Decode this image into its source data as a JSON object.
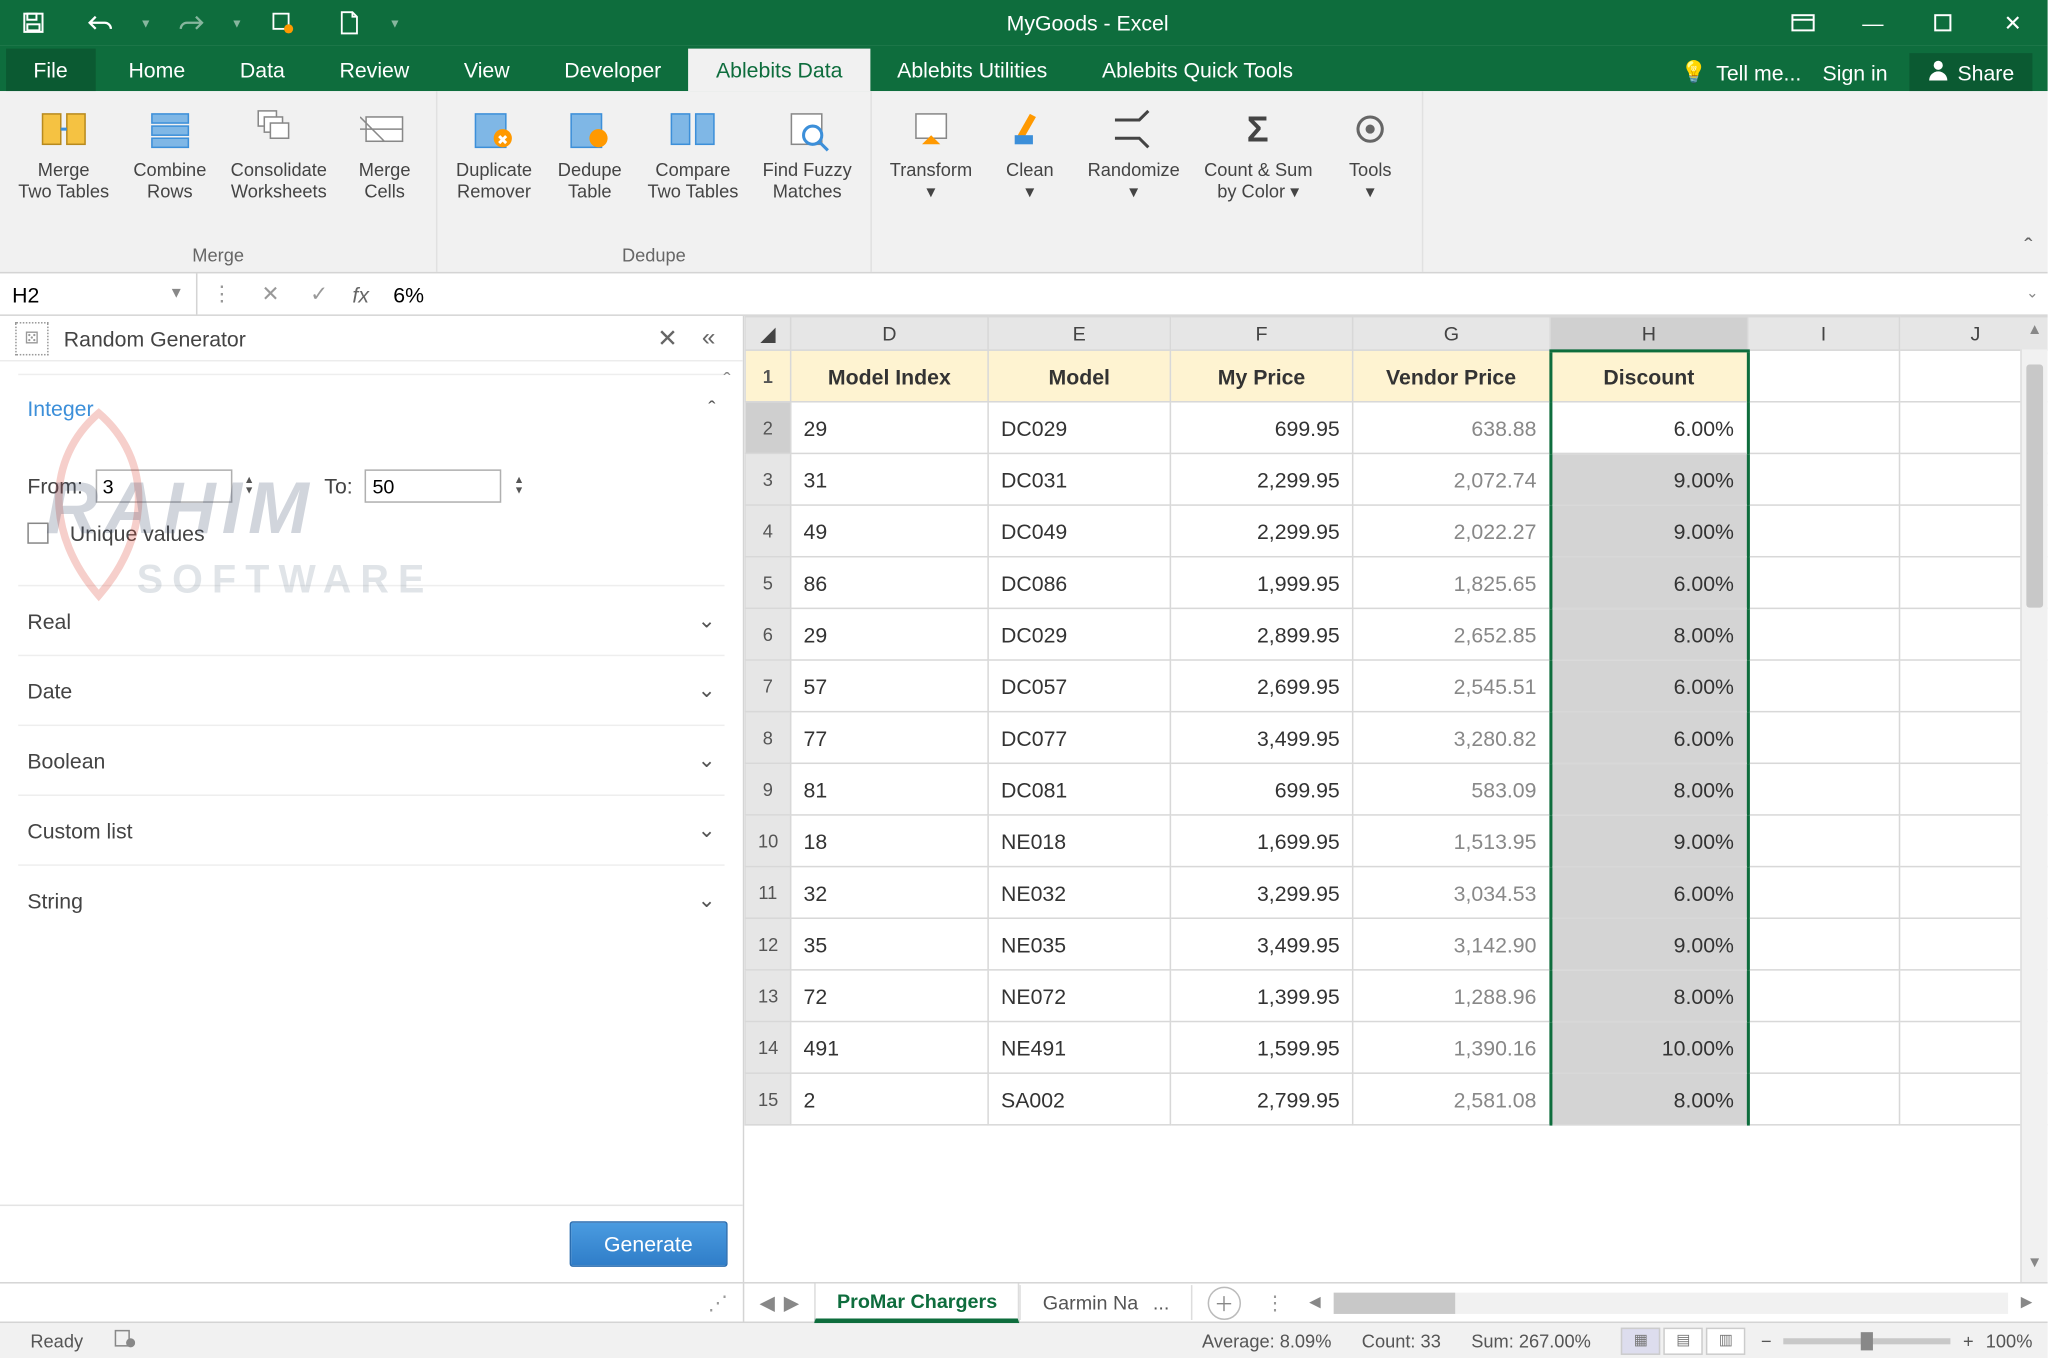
{
  "titlebar": {
    "title": "MyGoods - Excel"
  },
  "menu": {
    "file": "File",
    "tabs": [
      "Home",
      "Data",
      "Review",
      "View",
      "Developer",
      "Ablebits Data",
      "Ablebits Utilities",
      "Ablebits Quick Tools"
    ],
    "active": "Ablebits Data",
    "tell_me": "Tell me...",
    "sign_in": "Sign in",
    "share": "Share"
  },
  "ribbon": {
    "groups": [
      {
        "label": "Merge",
        "buttons": [
          {
            "label": "Merge\nTwo Tables",
            "icon": "merge-two-tables"
          },
          {
            "label": "Combine\nRows",
            "icon": "combine-rows"
          },
          {
            "label": "Consolidate\nWorksheets",
            "icon": "consolidate"
          },
          {
            "label": "Merge\nCells",
            "icon": "merge-cells"
          }
        ]
      },
      {
        "label": "Dedupe",
        "buttons": [
          {
            "label": "Duplicate\nRemover",
            "icon": "dup-remover"
          },
          {
            "label": "Dedupe\nTable",
            "icon": "dedupe-table"
          },
          {
            "label": "Compare\nTwo Tables",
            "icon": "compare"
          },
          {
            "label": "Find Fuzzy\nMatches",
            "icon": "fuzzy"
          }
        ]
      },
      {
        "label": "",
        "buttons": [
          {
            "label": "Transform\n▾",
            "icon": "transform"
          },
          {
            "label": "Clean\n▾",
            "icon": "clean"
          },
          {
            "label": "Randomize\n▾",
            "icon": "randomize"
          },
          {
            "label": "Count & Sum\nby Color ▾",
            "icon": "sigma"
          },
          {
            "label": "Tools\n▾",
            "icon": "gear"
          }
        ]
      }
    ]
  },
  "fbar": {
    "name": "H2",
    "value": "6%"
  },
  "taskpane": {
    "title": "Random Generator",
    "sections": [
      "Integer",
      "Real",
      "Date",
      "Boolean",
      "Custom list",
      "String"
    ],
    "from_label": "From:",
    "from_value": "3",
    "to_label": "To:",
    "to_value": "50",
    "unique": "Unique values",
    "generate": "Generate"
  },
  "columns": [
    "D",
    "E",
    "F",
    "G",
    "H",
    "I",
    "J"
  ],
  "headers": [
    "Model Index",
    "Model",
    "My Price",
    "Vendor Price",
    "Discount"
  ],
  "rows": [
    {
      "n": 2,
      "idx": "29",
      "model": "DC029",
      "price": "699.95",
      "vprice": "638.88",
      "disc": "6.00%",
      "active": true
    },
    {
      "n": 3,
      "idx": "31",
      "model": "DC031",
      "price": "2,299.95",
      "vprice": "2,072.74",
      "disc": "9.00%"
    },
    {
      "n": 4,
      "idx": "49",
      "model": "DC049",
      "price": "2,299.95",
      "vprice": "2,022.27",
      "disc": "9.00%"
    },
    {
      "n": 5,
      "idx": "86",
      "model": "DC086",
      "price": "1,999.95",
      "vprice": "1,825.65",
      "disc": "6.00%"
    },
    {
      "n": 6,
      "idx": "29",
      "model": "DC029",
      "price": "2,899.95",
      "vprice": "2,652.85",
      "disc": "8.00%"
    },
    {
      "n": 7,
      "idx": "57",
      "model": "DC057",
      "price": "2,699.95",
      "vprice": "2,545.51",
      "disc": "6.00%"
    },
    {
      "n": 8,
      "idx": "77",
      "model": "DC077",
      "price": "3,499.95",
      "vprice": "3,280.82",
      "disc": "6.00%"
    },
    {
      "n": 9,
      "idx": "81",
      "model": "DC081",
      "price": "699.95",
      "vprice": "583.09",
      "disc": "8.00%"
    },
    {
      "n": 10,
      "idx": "18",
      "model": "NE018",
      "price": "1,699.95",
      "vprice": "1,513.95",
      "disc": "9.00%"
    },
    {
      "n": 11,
      "idx": "32",
      "model": "NE032",
      "price": "3,299.95",
      "vprice": "3,034.53",
      "disc": "6.00%"
    },
    {
      "n": 12,
      "idx": "35",
      "model": "NE035",
      "price": "3,499.95",
      "vprice": "3,142.90",
      "disc": "9.00%"
    },
    {
      "n": 13,
      "idx": "72",
      "model": "NE072",
      "price": "1,399.95",
      "vprice": "1,288.96",
      "disc": "8.00%"
    },
    {
      "n": 14,
      "idx": "491",
      "model": "NE491",
      "price": "1,599.95",
      "vprice": "1,390.16",
      "disc": "10.00%"
    },
    {
      "n": 15,
      "idx": "2",
      "model": "SA002",
      "price": "2,799.95",
      "vprice": "2,581.08",
      "disc": "8.00%"
    }
  ],
  "sheets": {
    "active": "ProMar Chargers",
    "other": "Garmin Na",
    "ellipsis": "..."
  },
  "status": {
    "ready": "Ready",
    "avg": "Average: 8.09%",
    "count": "Count: 33",
    "sum": "Sum: 267.00%",
    "zoom": "100%"
  }
}
